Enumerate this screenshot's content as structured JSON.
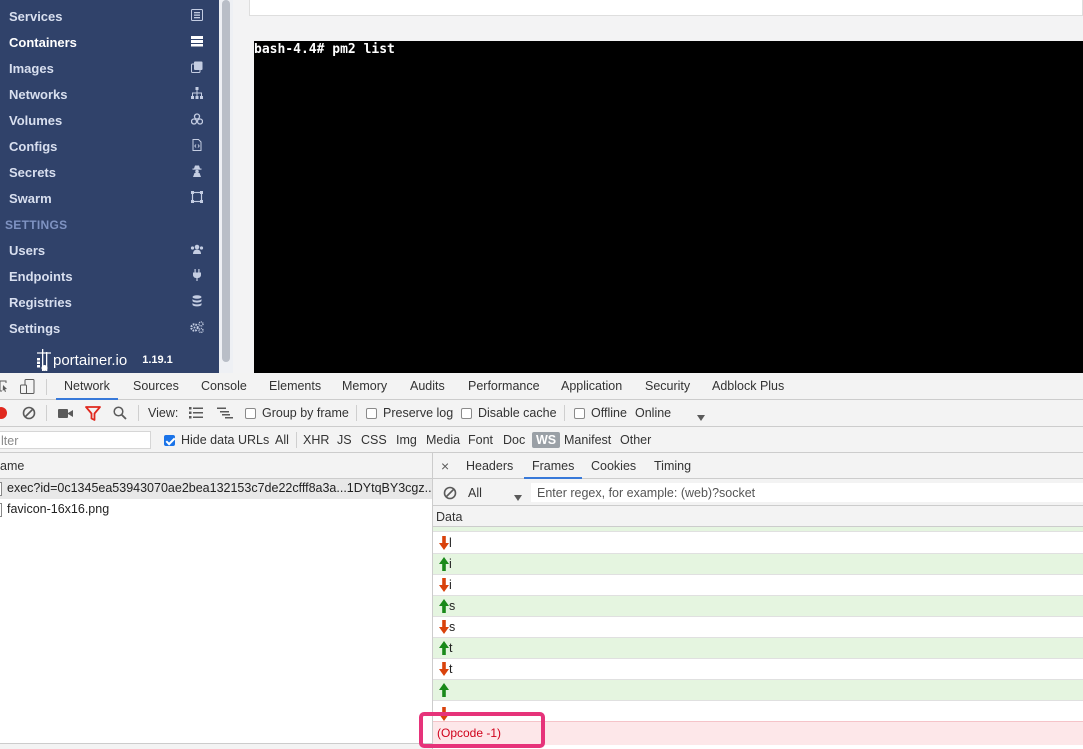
{
  "sidebar": {
    "items": [
      {
        "label": "Services",
        "icon": "list-icon"
      },
      {
        "label": "Containers",
        "icon": "server-icon",
        "active": true
      },
      {
        "label": "Images",
        "icon": "clone-icon"
      },
      {
        "label": "Networks",
        "icon": "sitemap-icon"
      },
      {
        "label": "Volumes",
        "icon": "cubes-icon"
      },
      {
        "label": "Configs",
        "icon": "file-code-icon"
      },
      {
        "label": "Secrets",
        "icon": "user-secret-icon"
      },
      {
        "label": "Swarm",
        "icon": "object-group-icon"
      }
    ],
    "settings_header": "SETTINGS",
    "settings_items": [
      {
        "label": "Users",
        "icon": "users-icon"
      },
      {
        "label": "Endpoints",
        "icon": "plug-icon"
      },
      {
        "label": "Registries",
        "icon": "database-icon"
      },
      {
        "label": "Settings",
        "icon": "cogs-icon"
      }
    ],
    "brand_name": "portainer.io",
    "version": "1.19.1"
  },
  "terminal": {
    "line": "bash-4.4# pm2 list"
  },
  "devtools": {
    "tabs": [
      "Network",
      "Sources",
      "Console",
      "Elements",
      "Memory",
      "Audits",
      "Performance",
      "Application",
      "Security",
      "Adblock Plus"
    ],
    "selected_tab": "Network",
    "toolbar": {
      "view_label": "View:",
      "group_by_frame": "Group by frame",
      "preserve_log": "Preserve log",
      "disable_cache": "Disable cache",
      "offline": "Offline",
      "throttle": "Online"
    },
    "filter": {
      "placeholder": "lter",
      "hide_data_urls": "Hide data URLs",
      "types": [
        "All",
        "XHR",
        "JS",
        "CSS",
        "Img",
        "Media",
        "Font",
        "Doc",
        "WS",
        "Manifest",
        "Other"
      ],
      "selected_type": "WS"
    },
    "requests": {
      "header": "ame",
      "rows": [
        {
          "name": "exec?id=0c1345ea53943070ae2bea132153c7de22cfff8a3a...1DYtqBY3cgz..."
        },
        {
          "name": "favicon-16x16.png"
        }
      ]
    },
    "detail": {
      "close": "×",
      "tabs": [
        "Headers",
        "Frames",
        "Cookies",
        "Timing"
      ],
      "selected_tab": "Frames",
      "frame_filter": "All",
      "regex_placeholder": "Enter regex, for example: (web)?socket",
      "data_header": "Data",
      "frames": [
        {
          "dir": "recv",
          "text": "l"
        },
        {
          "dir": "sent",
          "text": "i"
        },
        {
          "dir": "recv",
          "text": "i"
        },
        {
          "dir": "sent",
          "text": "s"
        },
        {
          "dir": "recv",
          "text": "s"
        },
        {
          "dir": "sent",
          "text": "t"
        },
        {
          "dir": "recv",
          "text": "t"
        },
        {
          "dir": "sent",
          "text": ""
        }
      ],
      "error_frame": "(Opcode -1)"
    },
    "colors": {
      "sent_bg": "#e5f5e0",
      "error_bg": "#fde7e9",
      "highlight": "#e6337a",
      "sent_arrow": "#1a8a1a",
      "recv_arrow": "#d9420b"
    }
  }
}
